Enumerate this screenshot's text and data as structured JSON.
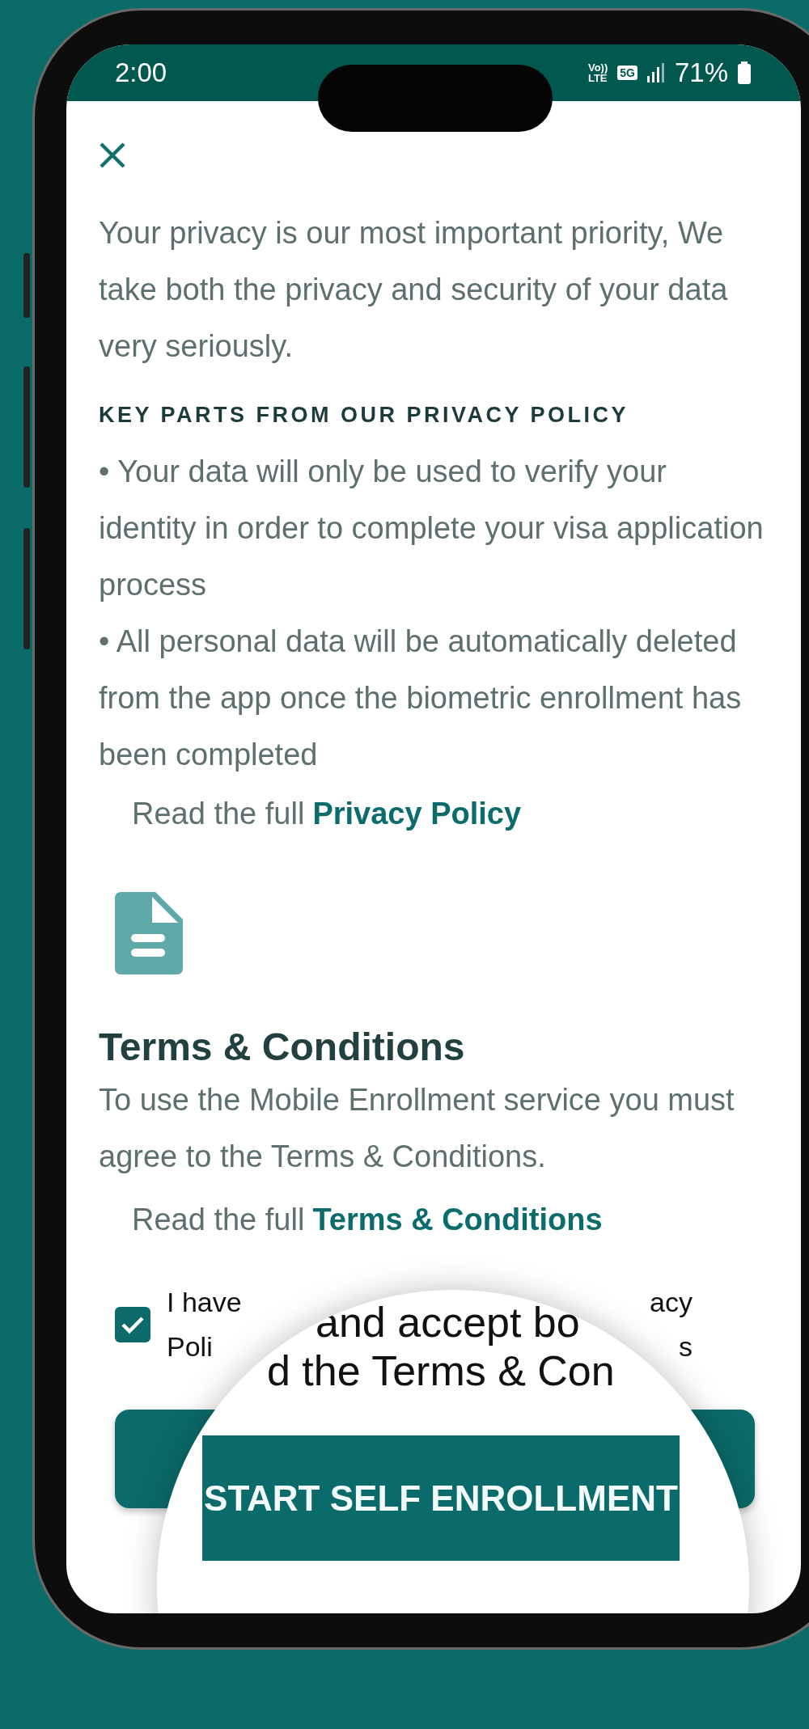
{
  "status_bar": {
    "time": "2:00",
    "volte_top": "Vo))",
    "volte_bottom": "LTE",
    "network": "5G",
    "battery_text": "71%"
  },
  "privacy": {
    "paragraph": "Your privacy is our most important priority, We take both the privacy and security of your data very seriously.",
    "key_parts_heading": "KEY PARTS FROM OUR PRIVACY POLICY",
    "bullets": [
      "• Your data will only be used to verify your identity in order to complete your visa application process",
      "• All personal data will be automatically deleted from the app once the biometric enrollment has been completed"
    ],
    "read_full_prefix": "Read the full",
    "read_full_link": "Privacy Policy"
  },
  "terms": {
    "heading": "Terms & Conditions",
    "paragraph": "To use the Mobile Enrollment service you must agree to the Terms & Conditions.",
    "read_full_prefix": "Read the full",
    "read_full_link": "Terms & Conditions"
  },
  "consent": {
    "checked": true,
    "line_1_start": "I have",
    "line_1_end": "acy",
    "line_2_start": "Poli",
    "line_2_end": "s"
  },
  "magnifier": {
    "line_1": "and accept bo",
    "line_2": "d the Terms & Con",
    "button": "START SELF ENROLLMENT"
  }
}
